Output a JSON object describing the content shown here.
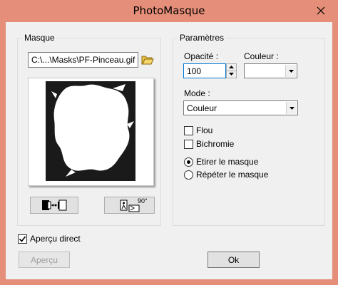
{
  "window": {
    "title": "PhotoMasque"
  },
  "mask_group": {
    "label": "Masque",
    "file_path": "C:\\...\\Masks\\PF-Pinceau.gif"
  },
  "params_group": {
    "label": "Paramètres",
    "opacity_label": "Opacité :",
    "opacity_value": "100",
    "color_label": "Couleur :",
    "color_value": "#ffffff",
    "mode_label": "Mode :",
    "mode_value": "Couleur",
    "blur_label": "Flou",
    "blur_checked": false,
    "bichromy_label": "Bichromie",
    "bichromy_checked": false,
    "stretch_label": "Etirer le masque",
    "stretch_selected": true,
    "repeat_label": "Répéter le masque",
    "repeat_selected": false
  },
  "bottom": {
    "live_preview_label": "Aperçu direct",
    "live_preview_checked": true,
    "preview_button": "Aperçu",
    "ok_button": "Ok"
  },
  "rotate_button": {
    "text": "90°"
  },
  "colors": {
    "titlebar": "#e58e79",
    "dialog_bg": "#f0f0f0"
  }
}
